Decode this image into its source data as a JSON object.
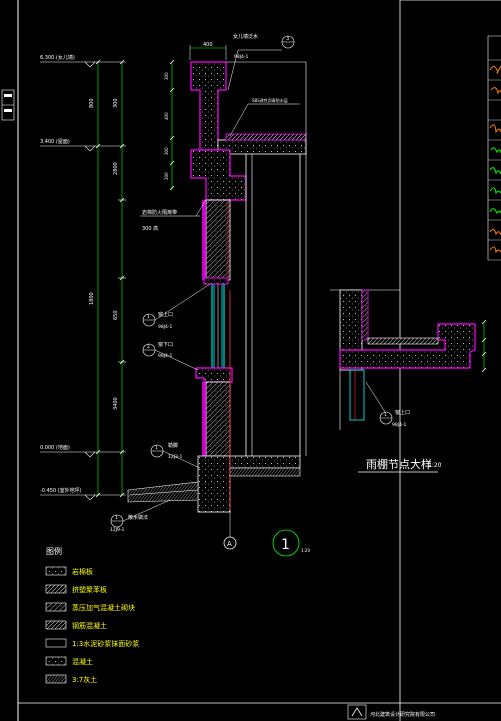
{
  "drawing": {
    "elevations": {
      "top": "6.300 (女儿墙)",
      "roof": "3.400 (屋面)",
      "floor": "0.000 (地面)",
      "ground": "-0.450 (室外地坪)"
    },
    "dims_left": [
      "300",
      "800",
      "2800",
      "1800",
      "650",
      "3400"
    ],
    "dims_top": [
      "400",
      "200"
    ],
    "labels": {
      "parapet_ref": "女儿墙泛水",
      "parapet_idx": "3",
      "parapet_sheet": "98J4-1",
      "roof_note": "SBS改性沥青防水层",
      "wall_note": "岩棉防火隔离带",
      "wall_note2": "300 高",
      "window_top_idx": "1",
      "window_top": "窗上口",
      "window_top_sheet": "98J4-1",
      "window_sill_idx": "2",
      "window_sill": "窗下口",
      "window_sill_sheet": "98J4-1",
      "plinth_idx": "1",
      "plinth": "勒脚",
      "plinth_sheet": "12J3-1",
      "apron_idx": "1",
      "apron": "散水做法",
      "apron_sheet": "12J9-1",
      "axis": "A",
      "detail_no": "1",
      "detail_scale": "1:20",
      "canopy_idx": "1",
      "canopy_ref": "窗上口",
      "canopy_sheet": "98J4-1"
    },
    "canopy_title": "雨棚节点大样",
    "canopy_scale": "1:20",
    "legend": {
      "title": "图例",
      "items": [
        "岩棉板",
        "挤塑聚苯板",
        "蒸压加气混凝土砌块",
        "钢筋混凝土",
        "1:3水泥砂浆抹面砂浆",
        "混凝土",
        "3:7灰土"
      ]
    },
    "titleblock": {
      "company": "河北建筑设计研究院有限公司"
    },
    "colors": {
      "background": "#000000",
      "line": "#ffffff",
      "accent_magenta": "#ff00ff",
      "accent_cyan": "#00ffff",
      "accent_yellow": "#ffff00",
      "accent_green": "#00ff00",
      "accent_red": "#ff3030"
    }
  }
}
